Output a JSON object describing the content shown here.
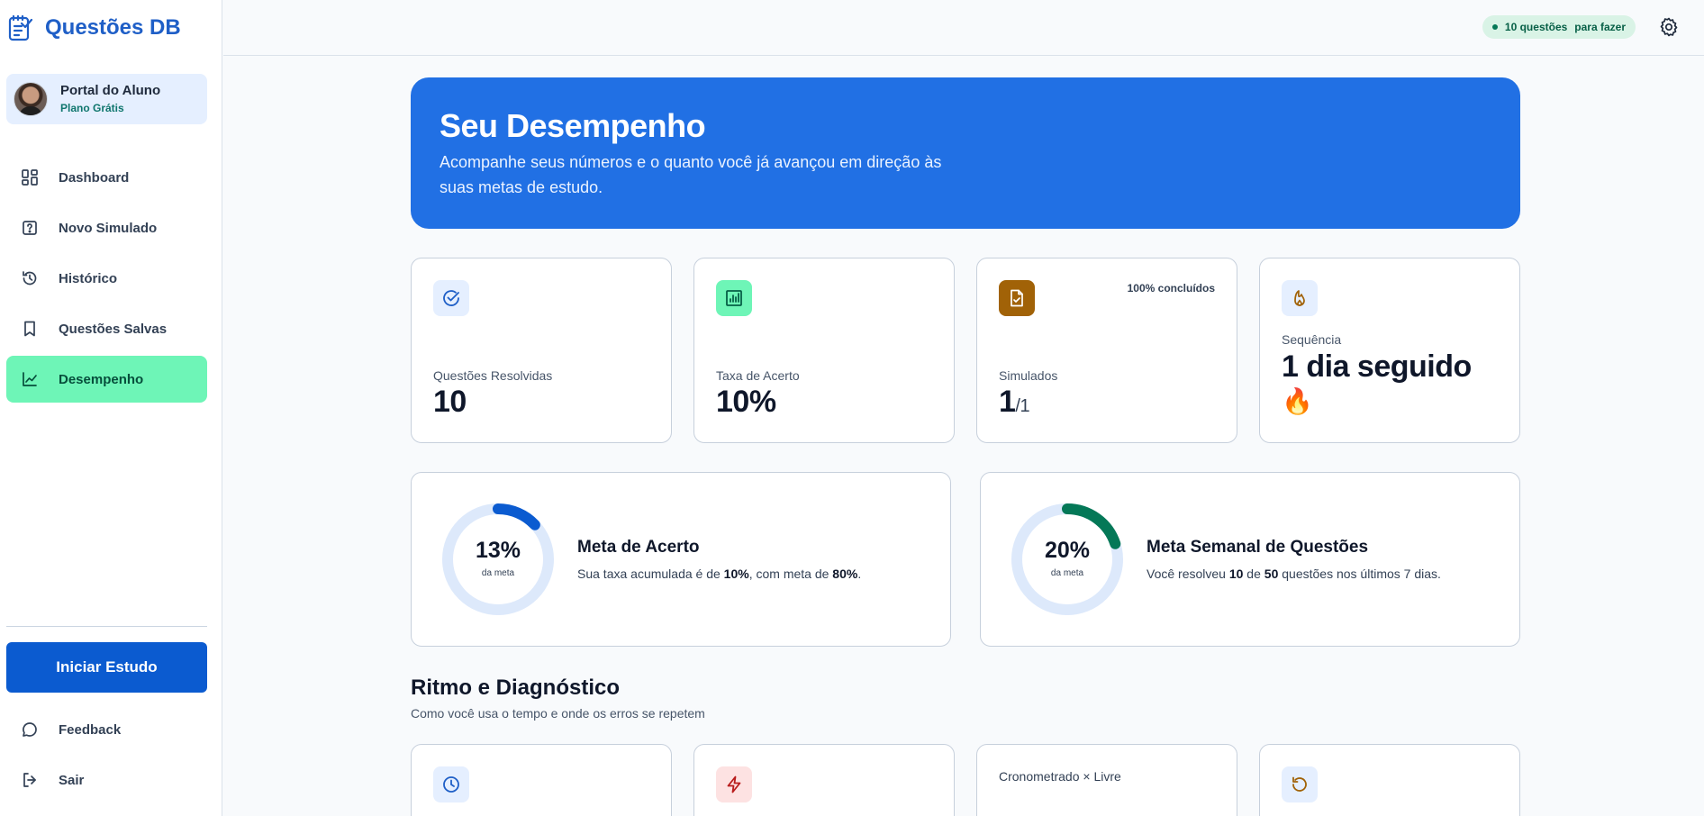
{
  "app": {
    "title": "Questões DB"
  },
  "user": {
    "name": "Portal do Aluno",
    "plan": "Plano Grátis"
  },
  "nav": [
    {
      "label": "Dashboard",
      "icon": "dashboard-icon"
    },
    {
      "label": "Novo Simulado",
      "icon": "question-icon"
    },
    {
      "label": "Histórico",
      "icon": "history-icon"
    },
    {
      "label": "Questões Salvas",
      "icon": "bookmark-icon"
    },
    {
      "label": "Desempenho",
      "icon": "chart-line-icon",
      "active": true
    }
  ],
  "sidebar_bottom": {
    "start_button": "Iniciar Estudo",
    "feedback": "Feedback",
    "logout": "Sair"
  },
  "topbar": {
    "pending_count": "10 questões",
    "pending_suffix": "para fazer"
  },
  "hero": {
    "title": "Seu Desempenho",
    "subtitle": "Acompanhe seus números e o quanto você já avançou em direção às suas metas de estudo."
  },
  "stats": [
    {
      "label": "Questões Resolvidas",
      "value": "10",
      "icon": "check-circle-icon",
      "color": "#e5efff"
    },
    {
      "label": "Taxa de Acerto",
      "value": "10%",
      "icon": "bar-chart-icon",
      "color": "#6ef5b7"
    },
    {
      "label": "Simulados",
      "value": "1",
      "value_suffix": "/1",
      "badge": "100% concluídos",
      "icon": "document-check-icon",
      "color": "#a16207"
    },
    {
      "label": "Sequência",
      "value": "1 dia seguido",
      "emoji": "🔥",
      "icon": "flame-icon",
      "color": "#e5efff"
    }
  ],
  "goals": [
    {
      "title": "Meta de Acerto",
      "percent_label": "13%",
      "percent": 13,
      "sub": "da meta",
      "color": "#0b5bd0",
      "desc_pre": "Sua taxa acumulada é de ",
      "desc_b1": "10%",
      "desc_mid": ", com meta de ",
      "desc_b2": "80%",
      "desc_post": "."
    },
    {
      "title": "Meta Semanal de Questões",
      "percent_label": "20%",
      "percent": 20,
      "sub": "da meta",
      "color": "#047857",
      "desc_pre": "Você resolveu ",
      "desc_b1": "10",
      "desc_mid": " de ",
      "desc_b2": "50",
      "desc_post": " questões nos últimos 7 dias."
    }
  ],
  "section": {
    "title": "Ritmo e Diagnóstico",
    "subtitle": "Como você usa o tempo e onde os erros se repetem"
  },
  "bottom_cards": [
    {
      "icon": "clock-icon"
    },
    {
      "icon": "lightning-icon"
    },
    {
      "label": "Cronometrado × Livre"
    },
    {
      "icon": "rotate-icon"
    }
  ]
}
